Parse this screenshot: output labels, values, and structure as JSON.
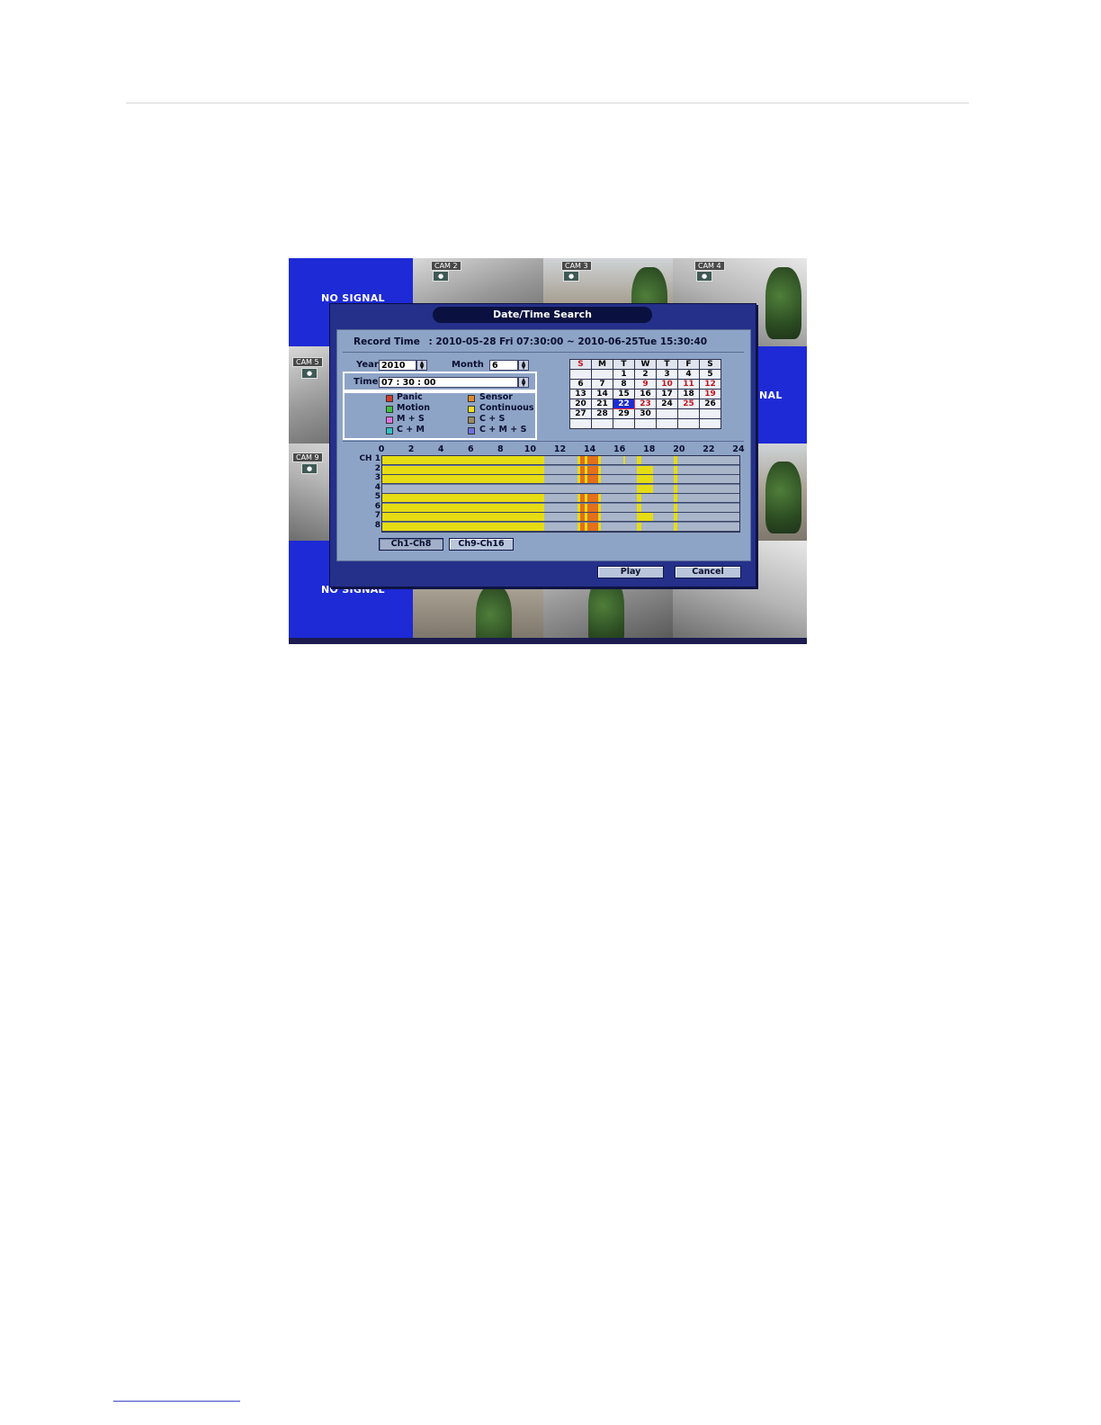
{
  "monitor": {
    "no_signal_top": "NO SIGNAL",
    "no_signal_bottom": "NO SIGNAL",
    "no_signal_right_partial": "NAL",
    "cams": [
      "CAM 2",
      "CAM 3",
      "CAM 4",
      "CAM 5",
      "CAM 9"
    ]
  },
  "dialog": {
    "title": "Date/Time Search",
    "record_time_label": "Record Time",
    "record_time_value": ": 2010-05-28 Fri  07:30:00 ~ 2010-06-25Tue 15:30:40",
    "year_label": "Year",
    "year_value": "2010",
    "month_label": "Month",
    "month_value": "6",
    "time_label": "Time",
    "time_value": "07 : 30 : 00",
    "legend": [
      {
        "label": "Panic",
        "color": "#d23a2a"
      },
      {
        "label": "Sensor",
        "color": "#e08a2a"
      },
      {
        "label": "Motion",
        "color": "#3fbf3f"
      },
      {
        "label": "Continuous",
        "color": "#f0e020"
      },
      {
        "label": "M + S",
        "color": "#e070e0"
      },
      {
        "label": "C + S",
        "color": "#9a8a60"
      },
      {
        "label": "C + M",
        "color": "#30c0c8"
      },
      {
        "label": "C + M + S",
        "color": "#7070e0"
      }
    ],
    "calendar": {
      "headers": [
        "S",
        "M",
        "T",
        "W",
        "T",
        "F",
        "S"
      ],
      "weeks": [
        [
          "",
          "",
          "1",
          "2",
          "3",
          "4",
          "5"
        ],
        [
          "6",
          "7",
          "8",
          "9",
          "10",
          "11",
          "12"
        ],
        [
          "13",
          "14",
          "15",
          "16",
          "17",
          "18",
          "19"
        ],
        [
          "20",
          "21",
          "22",
          "23",
          "24",
          "25",
          "26"
        ],
        [
          "27",
          "28",
          "29",
          "30",
          "",
          "",
          ""
        ],
        [
          "",
          "",
          "",
          "",
          "",
          "",
          ""
        ]
      ],
      "selected_day": "22",
      "highlighted_days": [
        "9",
        "10",
        "11",
        "12",
        "19",
        "23",
        "25"
      ]
    },
    "timeline": {
      "hour_ticks": [
        "0",
        "2",
        "4",
        "6",
        "8",
        "10",
        "12",
        "14",
        "16",
        "18",
        "20",
        "22",
        "24"
      ],
      "channel_labels": [
        "CH 1",
        "2",
        "3",
        "4",
        "5",
        "6",
        "7",
        "8"
      ],
      "channels": [
        {
          "segments": [
            {
              "start": 0,
              "end": 10.9,
              "type": "continuous"
            },
            {
              "start": 13.1,
              "end": 13.3,
              "type": "continuous"
            },
            {
              "start": 13.3,
              "end": 13.6,
              "type": "sensor"
            },
            {
              "start": 13.6,
              "end": 13.8,
              "type": "continuous"
            },
            {
              "start": 13.8,
              "end": 14.5,
              "type": "sensor"
            },
            {
              "start": 14.5,
              "end": 14.7,
              "type": "continuous"
            },
            {
              "start": 16.2,
              "end": 16.3,
              "type": "continuous"
            },
            {
              "start": 17.1,
              "end": 17.4,
              "type": "continuous"
            },
            {
              "start": 19.6,
              "end": 19.8,
              "type": "continuous"
            }
          ]
        },
        {
          "segments": [
            {
              "start": 0,
              "end": 10.9,
              "type": "continuous"
            },
            {
              "start": 13.1,
              "end": 13.3,
              "type": "continuous"
            },
            {
              "start": 13.3,
              "end": 13.6,
              "type": "sensor"
            },
            {
              "start": 13.6,
              "end": 13.8,
              "type": "continuous"
            },
            {
              "start": 13.8,
              "end": 14.5,
              "type": "sensor"
            },
            {
              "start": 14.5,
              "end": 14.7,
              "type": "continuous"
            },
            {
              "start": 17.1,
              "end": 18.2,
              "type": "continuous"
            },
            {
              "start": 19.6,
              "end": 19.8,
              "type": "continuous"
            }
          ]
        },
        {
          "segments": [
            {
              "start": 0,
              "end": 10.9,
              "type": "continuous"
            },
            {
              "start": 13.1,
              "end": 13.3,
              "type": "continuous"
            },
            {
              "start": 13.3,
              "end": 13.6,
              "type": "sensor"
            },
            {
              "start": 13.6,
              "end": 13.8,
              "type": "continuous"
            },
            {
              "start": 13.8,
              "end": 14.5,
              "type": "sensor"
            },
            {
              "start": 14.5,
              "end": 14.7,
              "type": "continuous"
            },
            {
              "start": 17.1,
              "end": 18.2,
              "type": "continuous"
            },
            {
              "start": 19.6,
              "end": 19.8,
              "type": "continuous"
            }
          ]
        },
        {
          "segments": [
            {
              "start": 17.1,
              "end": 18.2,
              "type": "continuous"
            },
            {
              "start": 19.6,
              "end": 19.8,
              "type": "continuous"
            }
          ]
        },
        {
          "segments": [
            {
              "start": 0,
              "end": 10.9,
              "type": "continuous"
            },
            {
              "start": 13.1,
              "end": 13.3,
              "type": "continuous"
            },
            {
              "start": 13.3,
              "end": 13.6,
              "type": "sensor"
            },
            {
              "start": 13.6,
              "end": 13.8,
              "type": "continuous"
            },
            {
              "start": 13.8,
              "end": 14.5,
              "type": "sensor"
            },
            {
              "start": 14.5,
              "end": 14.7,
              "type": "continuous"
            },
            {
              "start": 17.1,
              "end": 17.4,
              "type": "continuous"
            },
            {
              "start": 19.6,
              "end": 19.8,
              "type": "continuous"
            }
          ]
        },
        {
          "segments": [
            {
              "start": 0,
              "end": 10.9,
              "type": "continuous"
            },
            {
              "start": 13.1,
              "end": 13.3,
              "type": "continuous"
            },
            {
              "start": 13.3,
              "end": 13.6,
              "type": "sensor"
            },
            {
              "start": 13.6,
              "end": 13.8,
              "type": "continuous"
            },
            {
              "start": 13.8,
              "end": 14.5,
              "type": "sensor"
            },
            {
              "start": 14.5,
              "end": 14.7,
              "type": "continuous"
            },
            {
              "start": 17.1,
              "end": 17.4,
              "type": "continuous"
            },
            {
              "start": 19.6,
              "end": 19.8,
              "type": "continuous"
            }
          ]
        },
        {
          "segments": [
            {
              "start": 0,
              "end": 10.9,
              "type": "continuous"
            },
            {
              "start": 13.1,
              "end": 13.3,
              "type": "continuous"
            },
            {
              "start": 13.3,
              "end": 13.6,
              "type": "sensor"
            },
            {
              "start": 13.6,
              "end": 13.8,
              "type": "continuous"
            },
            {
              "start": 13.8,
              "end": 14.5,
              "type": "sensor"
            },
            {
              "start": 14.5,
              "end": 14.7,
              "type": "continuous"
            },
            {
              "start": 17.1,
              "end": 18.2,
              "type": "continuous"
            },
            {
              "start": 19.6,
              "end": 19.8,
              "type": "continuous"
            }
          ]
        },
        {
          "segments": [
            {
              "start": 0,
              "end": 10.9,
              "type": "continuous"
            },
            {
              "start": 13.1,
              "end": 13.3,
              "type": "continuous"
            },
            {
              "start": 13.3,
              "end": 13.6,
              "type": "sensor"
            },
            {
              "start": 13.6,
              "end": 13.8,
              "type": "continuous"
            },
            {
              "start": 13.8,
              "end": 14.5,
              "type": "sensor"
            },
            {
              "start": 14.5,
              "end": 14.7,
              "type": "continuous"
            },
            {
              "start": 17.1,
              "end": 17.4,
              "type": "continuous"
            },
            {
              "start": 19.6,
              "end": 19.8,
              "type": "continuous"
            }
          ]
        }
      ],
      "colors": {
        "continuous": "#e6dc14",
        "sensor": "#e2701c"
      }
    },
    "buttons": {
      "ch1_8": "Ch1-Ch8",
      "ch9_16": "Ch9-Ch16",
      "play": "Play",
      "cancel": "Cancel"
    }
  }
}
